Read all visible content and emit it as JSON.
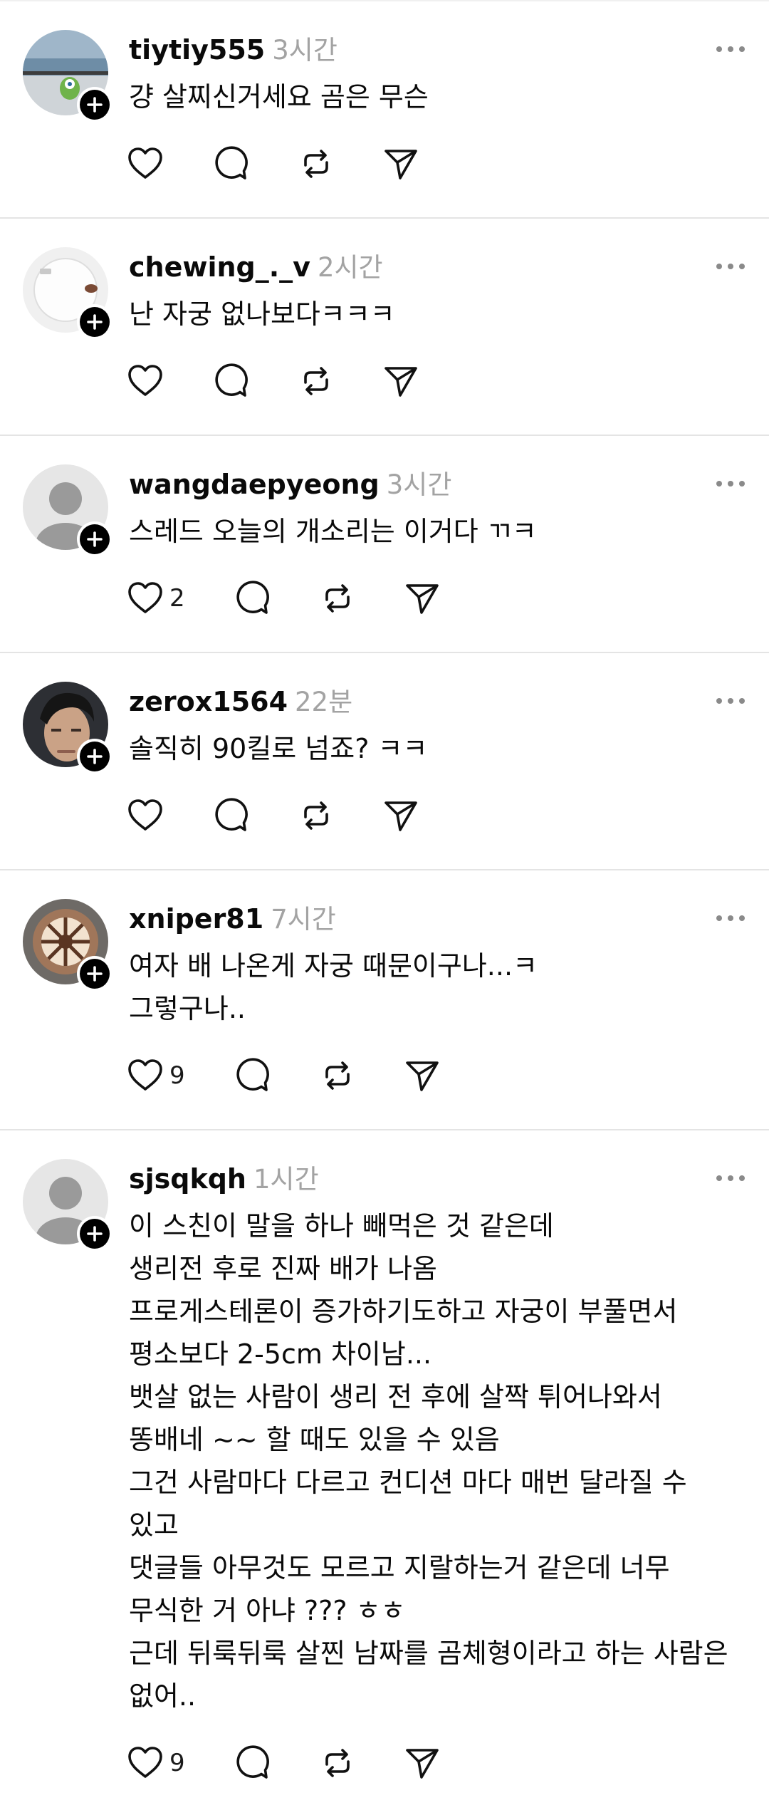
{
  "posts": [
    {
      "username": "tiytiy555",
      "time": "3시간",
      "lines": [
        "걍 살찌신거세요 곰은 무슨"
      ],
      "likes": "",
      "avatar_type": "seaside-photo"
    },
    {
      "username": "chewing_._v",
      "time": "2시간",
      "lines": [
        "난 자궁 없나보다ㅋㅋㅋ"
      ],
      "likes": "",
      "avatar_type": "white-photo"
    },
    {
      "username": "wangdaepyeong",
      "time": "3시간",
      "lines": [
        "스레드 오늘의 개소리는 이거다 ㄲㅋ"
      ],
      "likes": "2",
      "avatar_type": "default"
    },
    {
      "username": "zerox1564",
      "time": "22분",
      "lines": [
        "솔직히 90킬로 넘죠? ㅋㅋ"
      ],
      "likes": "",
      "avatar_type": "person-photo"
    },
    {
      "username": "xniper81",
      "time": "7시간",
      "lines": [
        "여자 배 나온게 자궁 때문이구나...ㅋ",
        "그렇구나.."
      ],
      "likes": "9",
      "avatar_type": "latte-photo"
    },
    {
      "username": "sjsqkqh",
      "time": "1시간",
      "lines": [
        "이 스친이 말을 하나 빼먹은 것 같은데",
        "생리전 후로 진짜 배가 나옴",
        "프로게스테론이 증가하기도하고 자궁이 부풀면서",
        "평소보다 2-5cm 차이남...",
        "뱃살 없는 사람이 생리 전 후에 살짝 튀어나와서",
        "똥배네 ~~ 할 때도 있을 수 있음",
        "그건 사람마다 다르고 컨디션 마다 매번 달라질 수",
        "있고",
        "댓글들 아무것도 모르고 지랄하는거 같은데 너무",
        "무식한 거 아냐 ??? ㅎㅎ",
        "근데 뒤룩뒤룩 살찐 남짜를 곰체형이라고 하는 사람은",
        "없어.."
      ],
      "likes": "9",
      "avatar_type": "default"
    }
  ],
  "icons": {
    "more": "more-icon",
    "follow": "plus-icon",
    "like": "heart-icon",
    "reply": "comment-icon",
    "repost": "repost-icon",
    "share": "send-icon"
  },
  "colors": {
    "text": "#0a0a0a",
    "meta": "#a3a3a3",
    "divider": "#e4e4e4"
  }
}
